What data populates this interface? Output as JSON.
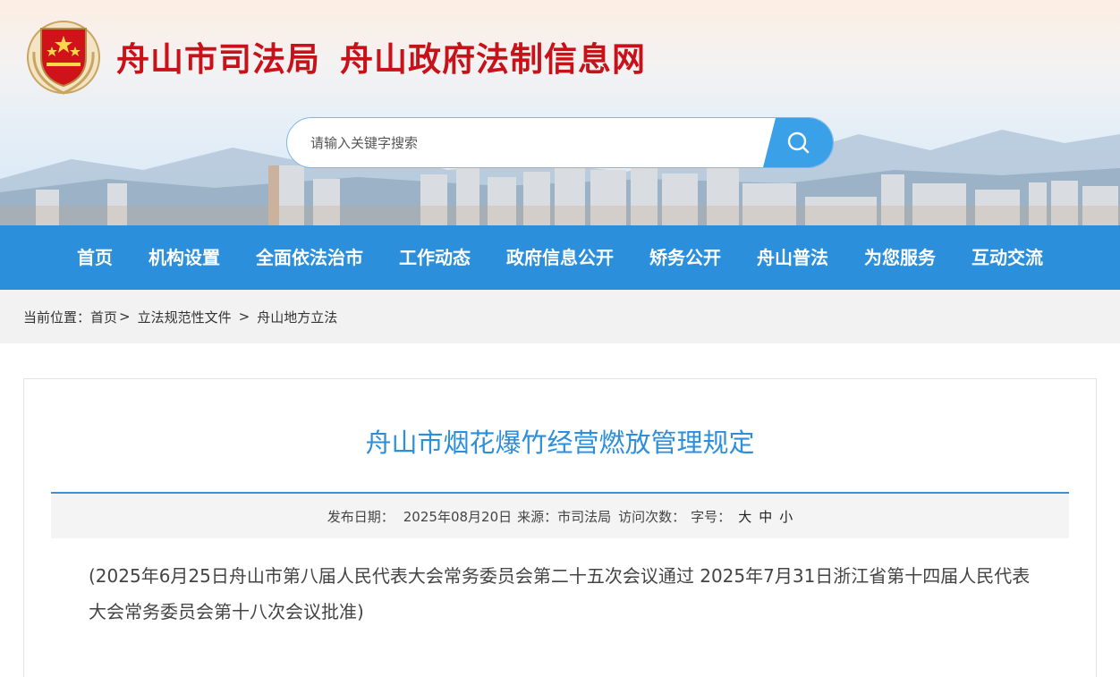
{
  "header": {
    "emblem_text": "中国司法",
    "title_part1": "舟山市司法局",
    "title_part2": "舟山政府法制信息网",
    "search": {
      "placeholder": "请输入关键字搜索"
    }
  },
  "nav": {
    "items": [
      "首页",
      "机构设置",
      "全面依法治市",
      "工作动态",
      "政府信息公开",
      "矫务公开",
      "舟山普法",
      "为您服务",
      "互动交流"
    ]
  },
  "breadcrumb": {
    "prefix": "当前位置：",
    "items": [
      "首页",
      "立法规范性文件",
      "舟山地方立法"
    ],
    "sep1": ">",
    "sep2": ">"
  },
  "article": {
    "title": "舟山市烟花爆竹经营燃放管理规定",
    "meta": {
      "date_label": "发布日期：",
      "date": "2025年08月20日",
      "source_label": "来源：",
      "source": "市司法局",
      "visits_label": "访问次数：",
      "font_label": "字号：",
      "sizes": [
        "大",
        "中",
        "小"
      ]
    },
    "lead": "(2025年6月25日舟山市第八届人民代表大会常务委员会第二十五次会议通过  2025年7月31日浙江省第十四届人民代表大会常务委员会第十八次会议批准)"
  },
  "colors": {
    "title_red": "#c8121a",
    "nav_blue": "#2b8fdc",
    "search_button": "#3aa0e8",
    "article_title": "#2b8fdc"
  }
}
